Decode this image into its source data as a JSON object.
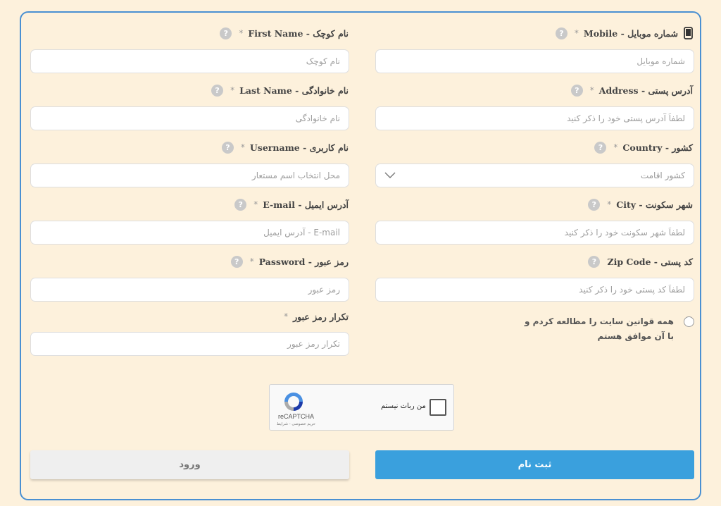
{
  "form": {
    "right": [
      {
        "id": "mobile",
        "label": "Mobile - شماره موبایل",
        "required": "*",
        "placeholder": "شماره موبایل",
        "icon": "mobile-phone-icon"
      },
      {
        "id": "address",
        "label": "Address - آدرس پستی",
        "required": "*",
        "placeholder": "لطفاً آدرس پستی خود را ذکر کنید"
      },
      {
        "id": "country",
        "label": "Country - کشور",
        "required": "*",
        "value": "کشور اقامت",
        "type": "select"
      },
      {
        "id": "city",
        "label": "City - شهر سکونت",
        "required": "*",
        "placeholder": "لطفاً شهر سکونت خود را ذکر کنید"
      },
      {
        "id": "zip",
        "label": "Zip Code - کد پستی",
        "required": "",
        "placeholder": "لطفاً کد پستی خود را ذکر کنید"
      }
    ],
    "left": [
      {
        "id": "first_name",
        "label": "First Name - نام کوچک",
        "required": "*",
        "placeholder": "نام کوچک"
      },
      {
        "id": "last_name",
        "label": "Last Name - نام خانوادگی",
        "required": "*",
        "placeholder": "نام خانوادگی"
      },
      {
        "id": "username",
        "label": "Username - نام کاربری",
        "required": "*",
        "placeholder": "محل انتخاب اسم مستعار"
      },
      {
        "id": "email",
        "label": "E-mail - آدرس ایمیل",
        "required": "*",
        "placeholder": "E-mail - آدرس ایمیل"
      },
      {
        "id": "password",
        "label": "Password - رمز عبور",
        "required": "*",
        "placeholder": "رمز عبور"
      },
      {
        "id": "password_repeat",
        "label": "تکرار رمز عبور",
        "required": "*",
        "placeholder": "تکرار رمز عبور"
      }
    ],
    "help_icon_text": "?",
    "terms": {
      "line1": "همه قوانین سایت را مطالعه کردم و",
      "line2": "با آن موافق هستم"
    }
  },
  "captcha": {
    "checkbox_label": "من ربات نیستم",
    "brand": "reCAPTCHA",
    "links": "حریم خصوصی - شرایط"
  },
  "buttons": {
    "register": "ثبت نام",
    "login": "ورود"
  },
  "colors": {
    "background": "#fdf1dc",
    "frame_border": "#4a90d2",
    "primary": "#3aa0dd",
    "secondary": "#efefef"
  }
}
